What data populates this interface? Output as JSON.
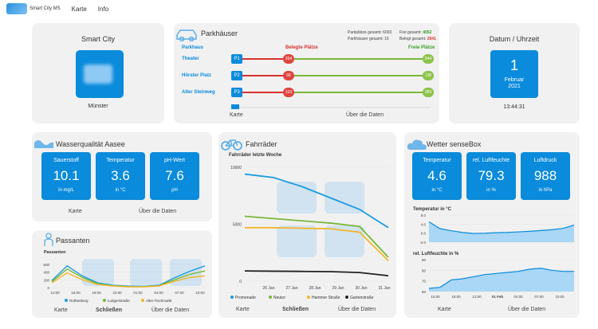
{
  "nav": {
    "brand": "Smart City MS",
    "links": [
      "Karte",
      "Info"
    ]
  },
  "smartcity": {
    "title": "Smart City",
    "city": "Münster"
  },
  "parking": {
    "title": "Parkhäuser",
    "stats": {
      "parkplaetze": "Parkplätze gesamt: 6093",
      "parkhaeuser": "Parkhäuser gesamt: 16",
      "frei_label": "Frei gesamt:",
      "frei": "4052",
      "belegt_label": "Belegt gesamt:",
      "belegt": "2041"
    },
    "headers": {
      "parkhaus": "Parkhaus",
      "belegt": "Belegte Plätze",
      "frei": "Freie Plätze"
    },
    "rows": [
      {
        "name": "Theater",
        "badge": "P1",
        "belegt": "204",
        "frei": "544"
      },
      {
        "name": "Hörster Platz",
        "badge": "P2",
        "belegt": "66",
        "frei": "136"
      },
      {
        "name": "Alter Steinweg",
        "badge": "P3",
        "belegt": "103",
        "frei": "283"
      }
    ],
    "links": [
      "Karte",
      "Über die Daten"
    ]
  },
  "datetime": {
    "title": "Datum / Uhrzeit",
    "day": "1",
    "month": "Februar",
    "year": "2021",
    "time": "13:44:31"
  },
  "water": {
    "title": "Wasserqualität Aasee",
    "tiles": [
      {
        "label": "Sauerstoff",
        "value": "10.1",
        "unit": "in mg/L"
      },
      {
        "label": "Temperatur",
        "value": "3.6",
        "unit": "in °C"
      },
      {
        "label": "pH-Wert",
        "value": "7.6",
        "unit": "pH"
      }
    ],
    "links": [
      "Karte",
      "Über die Daten"
    ]
  },
  "bikes": {
    "title": "Fahrräder",
    "links": [
      "Karte",
      "Schließen",
      "Über die Daten"
    ]
  },
  "weather": {
    "title": "Wetter senseBox",
    "tiles": [
      {
        "label": "Temperatur",
        "value": "4.6",
        "unit": "in °C"
      },
      {
        "label": "rel. Luftfeuchte",
        "value": "79.3",
        "unit": "in %"
      },
      {
        "label": "Luftdruck",
        "value": "988",
        "unit": "in hPa"
      }
    ],
    "links": [
      "Karte",
      "Über die Daten"
    ]
  },
  "pedestrians": {
    "title": "Passanten",
    "links": [
      "Karte",
      "Schließen",
      "Über die Daten"
    ]
  },
  "chart_data": [
    {
      "type": "line",
      "title": "Fahrräder letzte Woche",
      "x": [
        "26 Jan",
        "27 Jan",
        "28 Jan",
        "29 Jan",
        "30 Jan",
        "31 Jan"
      ],
      "ylim": [
        0,
        10000
      ],
      "yticks": [
        0,
        5000,
        10000
      ],
      "series": [
        {
          "name": "Promenade",
          "color": "#1a9be0",
          "values": [
            9400,
            9100,
            8300,
            7300,
            6300,
            4700
          ]
        },
        {
          "name": "Neutor",
          "color": "#7ab83a",
          "values": [
            5700,
            5500,
            5300,
            5100,
            4800,
            2100
          ]
        },
        {
          "name": "Hammer Straße",
          "color": "#f2b52e",
          "values": [
            4700,
            4700,
            4650,
            4600,
            4300,
            1800
          ]
        },
        {
          "name": "Gartenstraße",
          "color": "#222222",
          "values": [
            900,
            880,
            860,
            840,
            760,
            480
          ]
        }
      ]
    },
    {
      "type": "area",
      "title": "Temperatur in °C",
      "ylim": [
        -2,
        8
      ],
      "yticks": [
        "8.0",
        "4.0",
        "0.0",
        "-2.0"
      ],
      "values": [
        5.5,
        3,
        2.2,
        1.6,
        1.2,
        1.3,
        1.5,
        1.6,
        1.8,
        2.0,
        2.3,
        2.6,
        3.1,
        4.3
      ]
    },
    {
      "type": "area",
      "title": "rel. Luftfeuchte in %",
      "ylim": [
        60,
        90
      ],
      "yticks": [
        "90",
        "80",
        "70",
        "60"
      ],
      "xticks": [
        "15:00",
        "18:00",
        "21:00",
        "01 Feb",
        "04:00",
        "07:00",
        "10:00"
      ],
      "values": [
        63,
        64,
        71,
        72,
        74,
        76,
        77,
        78,
        79,
        81,
        82,
        80,
        79,
        79
      ]
    },
    {
      "type": "line",
      "title": "Passanten",
      "x": [
        "13:00",
        "16:00",
        "19:00",
        "22:00",
        "01:00",
        "04:00",
        "07:00",
        "10:00"
      ],
      "yticks": [
        0,
        200,
        400,
        600
      ],
      "ylim": [
        0,
        700
      ],
      "series": [
        {
          "name": "Rothenburg",
          "color": "#1a9be0",
          "values": [
            180,
            560,
            300,
            120,
            60,
            40,
            30,
            60,
            250,
            420,
            560
          ]
        },
        {
          "name": "Ludgeristraße",
          "color": "#7ab83a",
          "values": [
            150,
            480,
            260,
            100,
            50,
            30,
            25,
            50,
            200,
            340,
            430
          ]
        },
        {
          "name": "Alter Fischmarkt",
          "color": "#f2b52e",
          "values": [
            120,
            380,
            200,
            80,
            40,
            20,
            20,
            40,
            160,
            260,
            300
          ]
        }
      ]
    }
  ]
}
